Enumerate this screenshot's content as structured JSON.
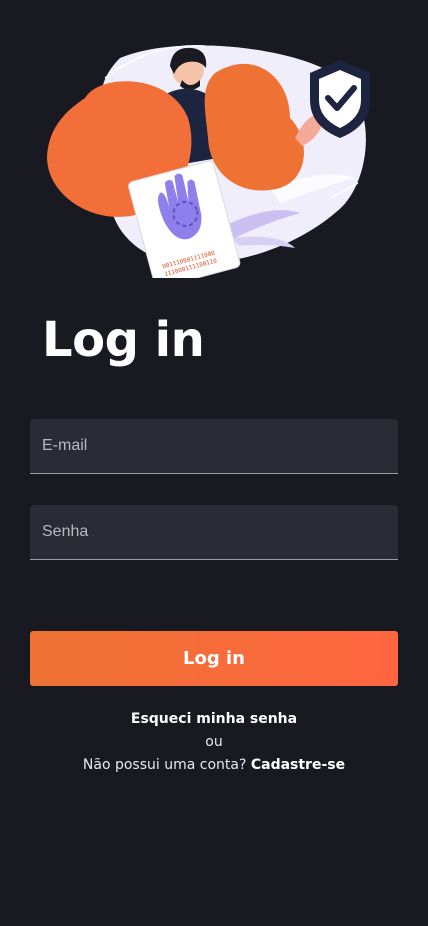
{
  "auth": {
    "title": "Log in",
    "email_placeholder": "E-mail",
    "password_placeholder": "Senha",
    "submit_label": "Log in",
    "forgot_password": "Esqueci minha senha",
    "separator": "ou",
    "no_account_text": "Não possui uma conta?",
    "signup_link": "Cadastre-se"
  },
  "illustration": {
    "binary_line_1": "001110001111000",
    "binary_line_2": "111000111100110"
  },
  "colors": {
    "background": "#181921",
    "accent": "#ff6640",
    "input_bg": "#2a2b35"
  }
}
